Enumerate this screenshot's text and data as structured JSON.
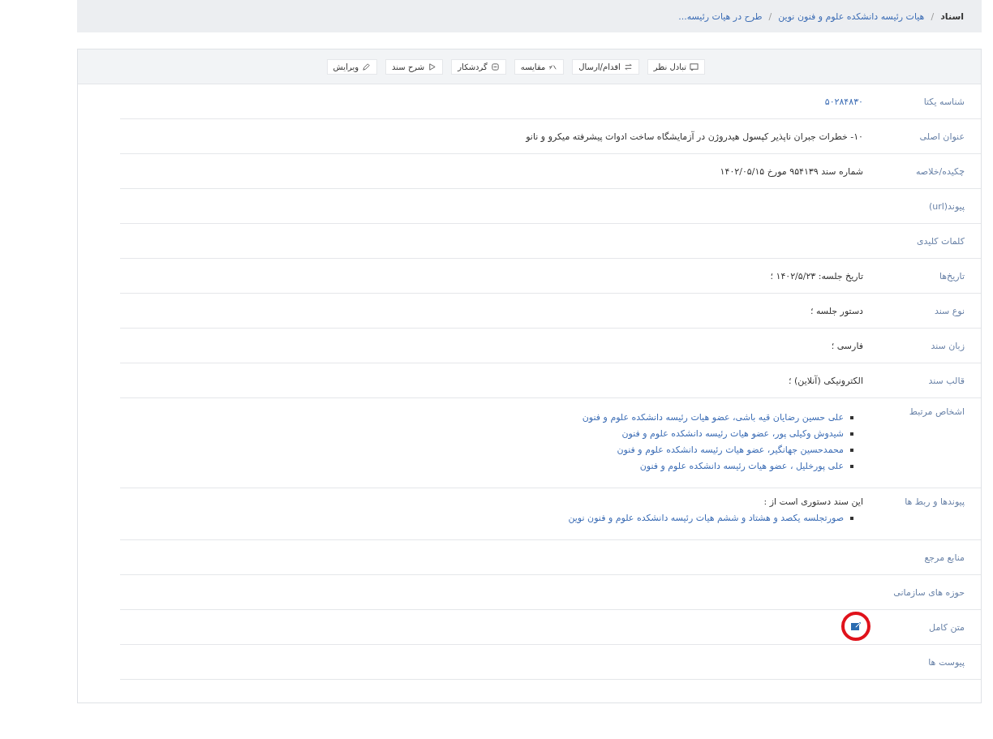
{
  "breadcrumb_separator": "/",
  "breadcrumb": [
    {
      "kind": "text",
      "label": "اسناد"
    },
    {
      "kind": "link",
      "label": "هیات رئیسه دانشکده علوم و فنون نوین"
    },
    {
      "kind": "link",
      "label": "طرح در هیات رئیسه..."
    }
  ],
  "toolbar": [
    "تبادل نظر",
    "اقدام/ارسال",
    "مقایسه",
    "گردشکار",
    "شرح سند",
    "ویرایش"
  ],
  "rows": [
    {
      "label": "شناسه یکتا",
      "kind": "link",
      "value": "۵۰۲۸۴۸۳۰"
    },
    {
      "label": "عنوان اصلی",
      "kind": "text",
      "value": "۱۰- خطرات جبران ناپذیر کپسول هیدروژن در آزمایشگاه ساخت ادوات پیشرفته میکرو و نانو"
    },
    {
      "label": "چکیده/خلاصه",
      "kind": "text",
      "value": "شماره سند ۹۵۴۱۳۹ مورخ ۱۴۰۲/۰۵/۱۵"
    },
    {
      "label": "پیوند(url)",
      "kind": "empty"
    },
    {
      "label": "کلمات کلیدی",
      "kind": "empty"
    },
    {
      "label": "تاریخ‌ها",
      "kind": "text",
      "value": "تاریخ جلسه: ۱۴۰۲/۵/۲۳ ؛"
    },
    {
      "label": "نوع سند",
      "kind": "text",
      "value": "دستور جلسه ؛"
    },
    {
      "label": "زبان سند",
      "kind": "text",
      "value": "فارسی ؛"
    },
    {
      "label": "قالب سند",
      "kind": "text",
      "value": "الکترونیکی (آنلاین) ؛"
    },
    {
      "label": "اشخاص مرتبط",
      "kind": "list",
      "items": [
        "علی حسین رضایان قیه باشی، عضو هیات رئیسه دانشکده علوم و فنون",
        "شیدوش وکیلی پور، عضو هیات رئیسه دانشکده علوم و فنون",
        "محمدحسین جهانگیر، عضو هیات رئیسه دانشکده علوم و فنون",
        "علی پورخلیل ، عضو هیات رئیسه دانشکده علوم و فنون"
      ]
    },
    {
      "label": "پیوندها و ربط ها",
      "kind": "list",
      "value": "این سند دستوری است از :",
      "items": [
        "صورتجلسه یکصد و هشتاد و ششم هیات رئیسه دانشکده علوم و فنون نوین"
      ]
    },
    {
      "label": "منابع مرجع",
      "kind": "empty"
    },
    {
      "label": "حوزه های سازمانی",
      "kind": "empty"
    },
    {
      "label": "متن کامل",
      "kind": "icon"
    },
    {
      "label": "پیوست ها",
      "kind": "empty"
    }
  ]
}
